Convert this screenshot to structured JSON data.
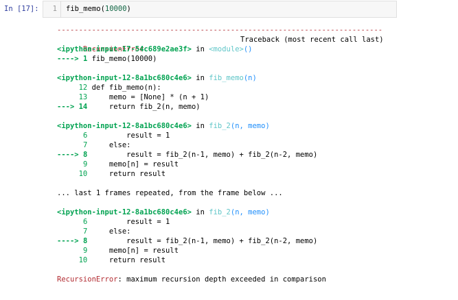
{
  "prompt": "In [17]:",
  "input": {
    "line_number": "1",
    "code_func": "fib_memo(",
    "code_arg": "10000",
    "code_close": ")"
  },
  "output": {
    "dashes": "---------------------------------------------------------------------------",
    "error_name": "RecursionError",
    "traceback_label": "Traceback (most recent call last)",
    "frames": [
      {
        "file": "<ipython-input-17-54c689e2ae3f>",
        "in_word": " in ",
        "func": "<module>",
        "args": "()",
        "lines": [
          {
            "arrow": "----> ",
            "num": "1",
            "code": " fib_memo(10000)",
            "current": true
          }
        ]
      },
      {
        "file": "<ipython-input-12-8a1bc680c4e6>",
        "in_word": " in ",
        "func": "fib_memo",
        "args": "(n)",
        "lines": [
          {
            "arrow": "     ",
            "num": "12",
            "code": " def fib_memo(n):",
            "current": false
          },
          {
            "arrow": "     ",
            "num": "13",
            "code": "     memo = [None] * (n + 1)",
            "current": false
          },
          {
            "arrow": "---> ",
            "num": "14",
            "code": "     return fib_2(n, memo)",
            "current": true
          }
        ]
      },
      {
        "file": "<ipython-input-12-8a1bc680c4e6>",
        "in_word": " in ",
        "func": "fib_2",
        "args": "(n, memo)",
        "lines": [
          {
            "arrow": "      ",
            "num": "6",
            "code": "         result = 1",
            "current": false
          },
          {
            "arrow": "      ",
            "num": "7",
            "code": "     else:",
            "current": false
          },
          {
            "arrow": "----> ",
            "num": "8",
            "code": "         result = fib_2(n-1, memo) + fib_2(n-2, memo)",
            "current": true
          },
          {
            "arrow": "      ",
            "num": "9",
            "code": "     memo[n] = result",
            "current": false
          },
          {
            "arrow": "     ",
            "num": "10",
            "code": "     return result",
            "current": false
          }
        ]
      }
    ],
    "repeated_note": "... last 1 frames repeated, from the frame below ...",
    "repeat_frame": {
      "file": "<ipython-input-12-8a1bc680c4e6>",
      "in_word": " in ",
      "func": "fib_2",
      "args": "(n, memo)",
      "lines": [
        {
          "arrow": "      ",
          "num": "6",
          "code": "         result = 1",
          "current": false
        },
        {
          "arrow": "      ",
          "num": "7",
          "code": "     else:",
          "current": false
        },
        {
          "arrow": "----> ",
          "num": "8",
          "code": "         result = fib_2(n-1, memo) + fib_2(n-2, memo)",
          "current": true
        },
        {
          "arrow": "      ",
          "num": "9",
          "code": "     memo[n] = result",
          "current": false
        },
        {
          "arrow": "     ",
          "num": "10",
          "code": "     return result",
          "current": false
        }
      ]
    },
    "final_error_name": "RecursionError",
    "final_error_msg": ": maximum recursion depth exceeded in comparison"
  }
}
